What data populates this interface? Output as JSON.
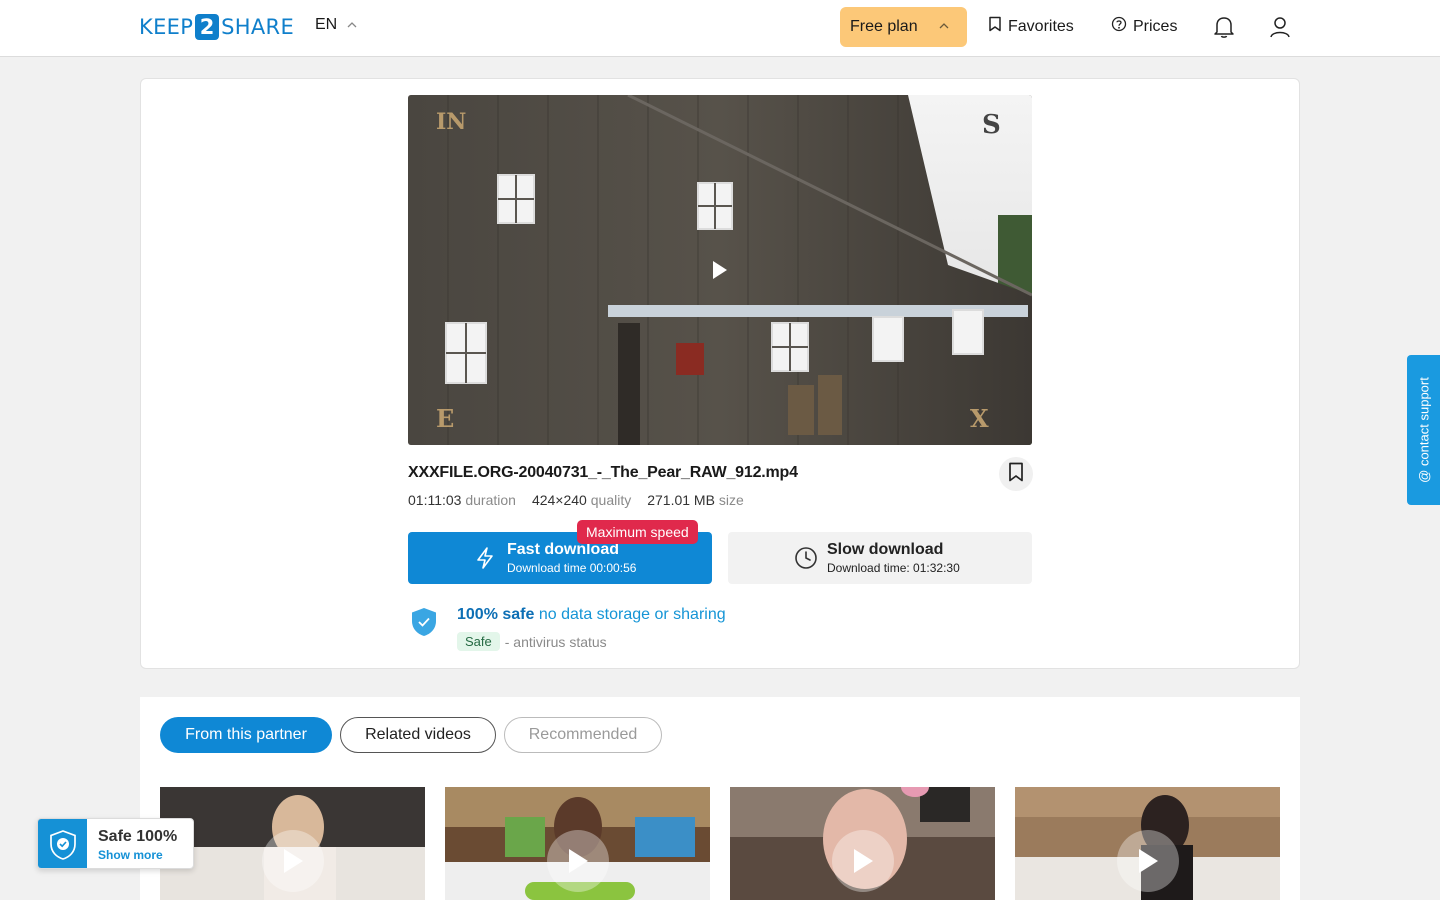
{
  "header": {
    "logo_left": "KEEP",
    "logo_mid": "2",
    "logo_right": "SHARE",
    "language": "EN",
    "plan_label": "Free plan",
    "favorites_label": "Favorites",
    "prices_label": "Prices",
    "icons": [
      "chevron-up-icon",
      "bookmark-icon",
      "help-circle-icon",
      "bell-icon",
      "user-icon"
    ]
  },
  "file": {
    "name": "XXXFILE.ORG-20040731_-_The_Pear_RAW_912.mp4",
    "duration": "01:11:03",
    "duration_label": "duration",
    "quality": "424×240",
    "quality_label": "quality",
    "size": "271.01 MB",
    "size_label": "size"
  },
  "video": {
    "corner_tl": "IN",
    "corner_tr": "S",
    "corner_bl": "E",
    "corner_br": "X"
  },
  "download": {
    "fast_title": "Fast download",
    "fast_sub": "Download time 00:00:56",
    "badge": "Maximum speed",
    "slow_title": "Slow download",
    "slow_sub": "Download time: 01:32:30"
  },
  "safety": {
    "headline_bold": "100% safe",
    "headline_rest": "no data storage or sharing",
    "status_badge": "Safe",
    "status_text": "- antivirus status"
  },
  "tabs": [
    {
      "label": "From this partner",
      "state": "active"
    },
    {
      "label": "Related videos",
      "state": "outline"
    },
    {
      "label": "Recommended",
      "state": "muted"
    }
  ],
  "support": {
    "label": "@ contact support"
  },
  "safe_popup": {
    "title": "Safe 100%",
    "link": "Show more"
  },
  "colors": {
    "accent": "#0f88d5",
    "plan": "#fcc878",
    "badge": "#e0294c",
    "support": "#1a9ae0"
  }
}
